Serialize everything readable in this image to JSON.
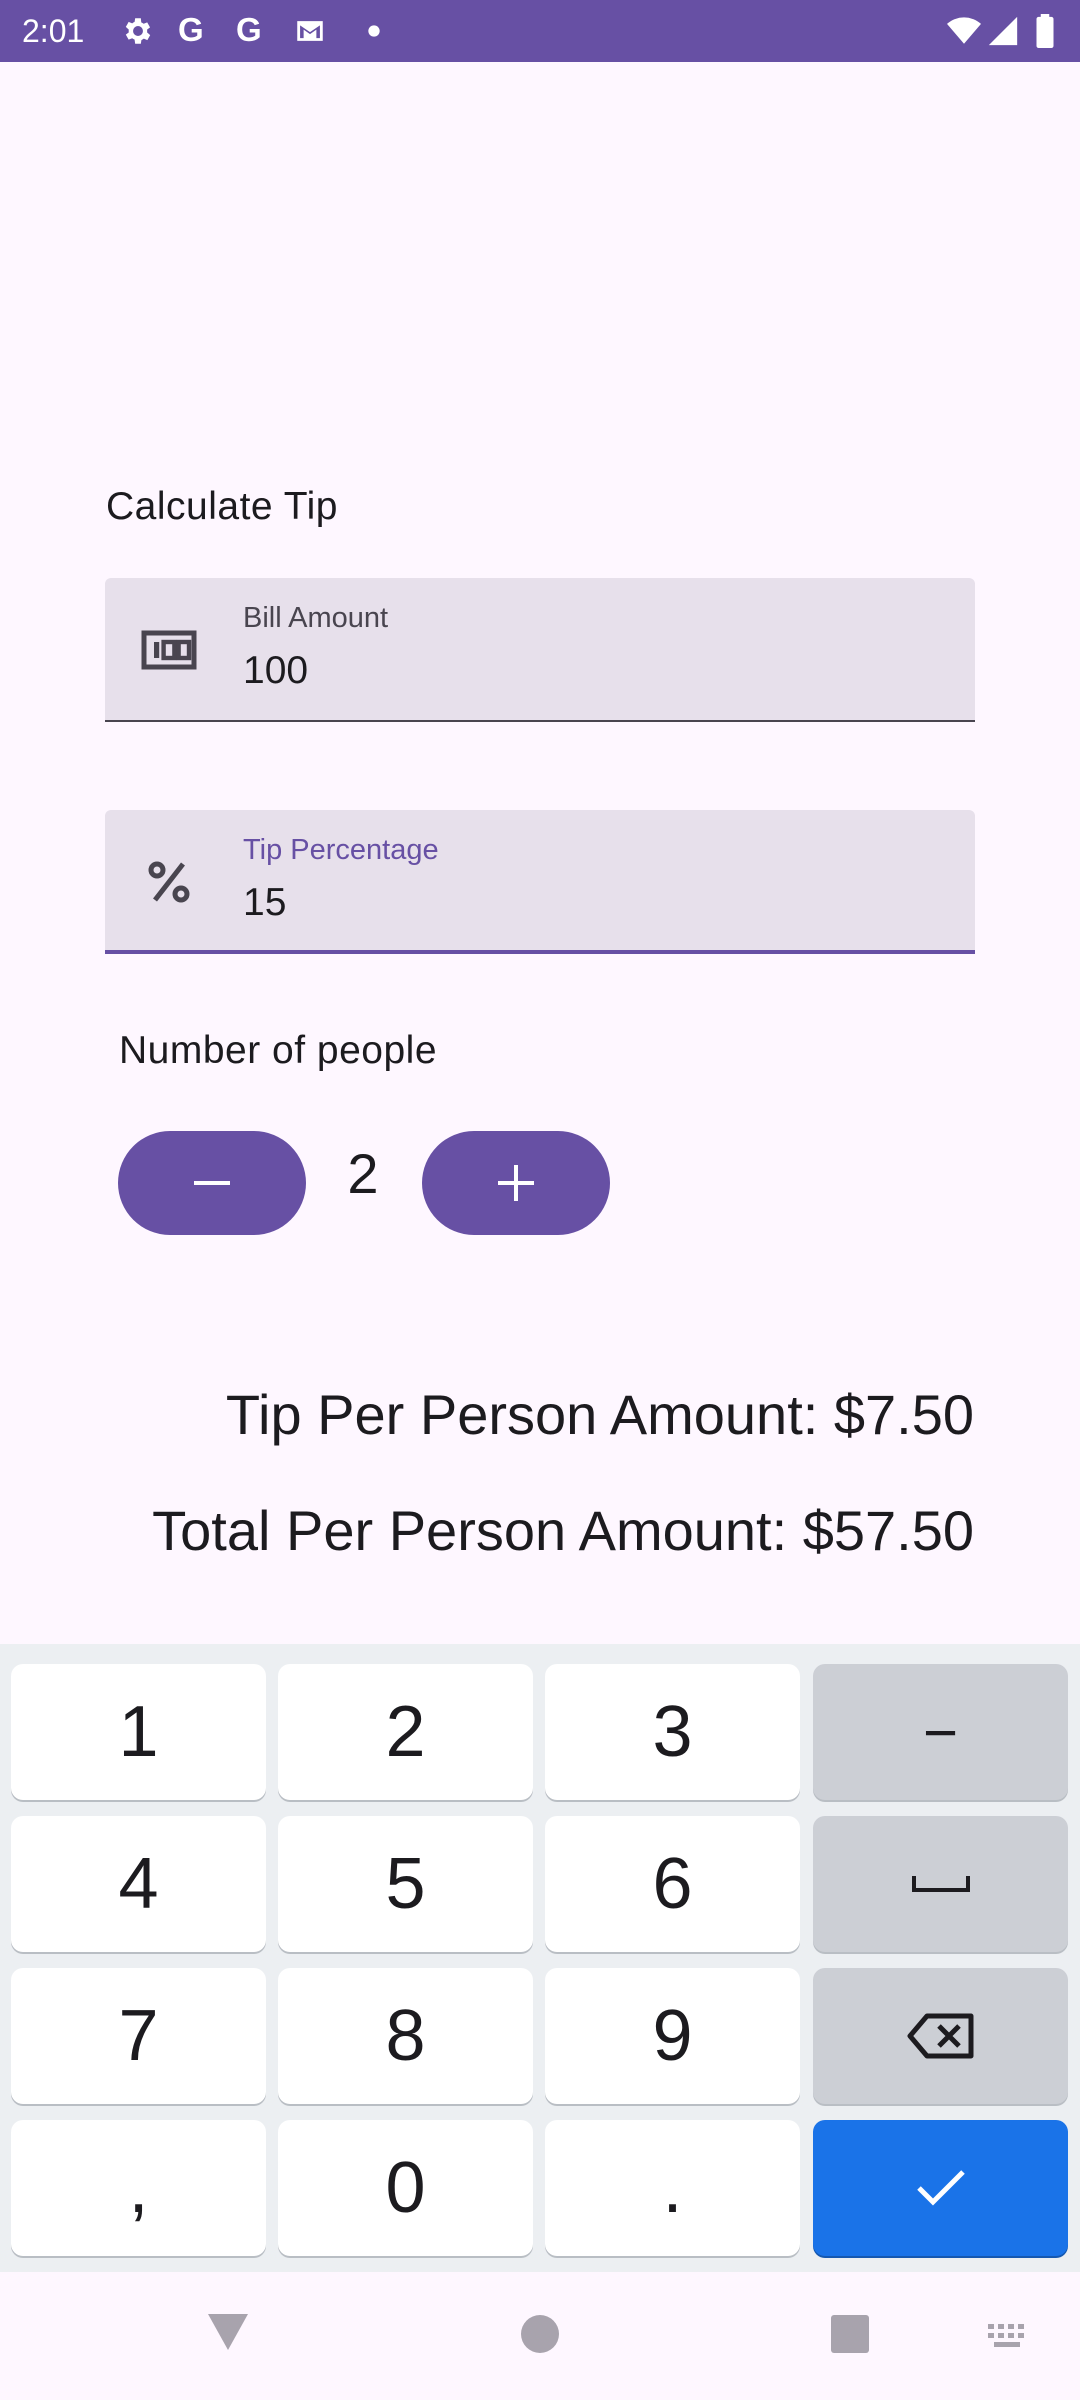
{
  "status_bar": {
    "time": "2:01",
    "left_icons": [
      "settings-icon",
      "google-icon",
      "google-icon",
      "gmail-icon",
      "dot-icon"
    ],
    "right_icons": [
      "wifi-icon",
      "signal-icon",
      "battery-icon"
    ],
    "g1": "G",
    "g2": "G"
  },
  "screen": {
    "title": "Calculate Tip",
    "bill_field": {
      "label": "Bill Amount",
      "value": "100",
      "icon": "money-icon"
    },
    "tip_field": {
      "label": "Tip Percentage",
      "value": "15",
      "icon": "percent-icon"
    },
    "people": {
      "label": "Number of people",
      "count": "2"
    },
    "results": {
      "tip_per_person": "Tip Per Person Amount: $7.50",
      "total_per_person": "Total Per Person Amount: $57.50"
    }
  },
  "keyboard": {
    "keys": [
      "1",
      "2",
      "3",
      "−",
      "4",
      "5",
      "6",
      "",
      "7",
      "8",
      "9",
      "",
      ",",
      "0",
      ".",
      ""
    ],
    "special_icons": [
      "space-icon",
      "backspace-icon",
      "check-icon"
    ]
  },
  "nav_bar": {
    "buttons": [
      "back-icon",
      "home-icon",
      "recents-icon",
      "keyboard-switch-icon"
    ]
  },
  "colors": {
    "primary": "#6750A4",
    "field_bg": "#E7E0EB",
    "enter_key": "#1A73E8",
    "background": "#FEF7FF"
  }
}
